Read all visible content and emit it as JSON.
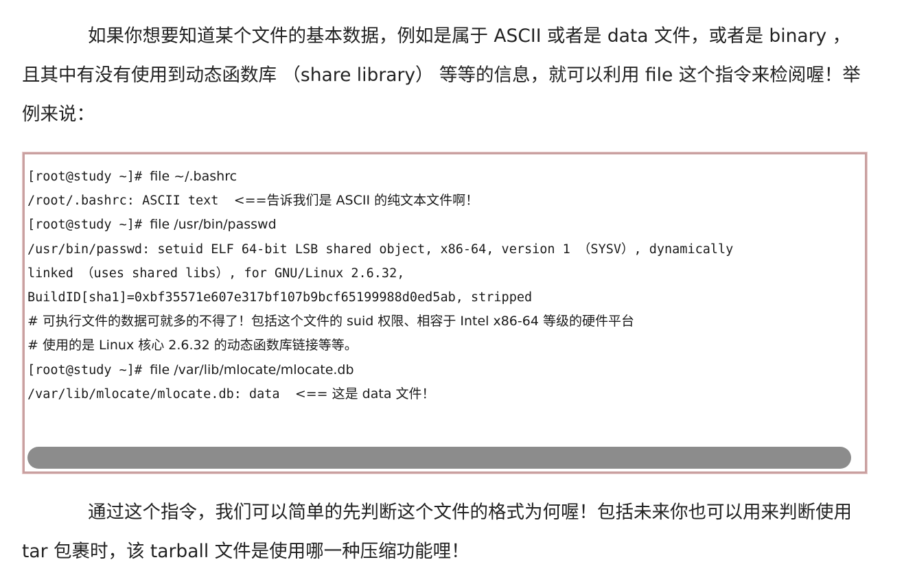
{
  "intro_paragraph": "如果你想要知道某个文件的基本数据，例如是属于 ASCII 或者是 data 文件，或者是 binary ， 且其中有没有使用到动态函数库 （share library） 等等的信息，就可以利用 file 这个指令来检阅喔！举例来说：",
  "code_block": {
    "lines": [
      {
        "mono": "[root@study ~]# ",
        "prose": "file ~/.bashrc"
      },
      {
        "mono": "/root/.bashrc: ASCII text  ",
        "prose": "<==告诉我们是 ASCII 的纯文本文件啊！"
      },
      {
        "mono": "[root@study ~]# ",
        "prose": "file /usr/bin/passwd"
      },
      {
        "mono": "/usr/bin/passwd: setuid ELF 64-bit LSB shared object, x86-64, version 1 （SYSV）, dynamically",
        "prose": ""
      },
      {
        "mono": "linked （uses shared libs）, for GNU/Linux 2.6.32,",
        "prose": ""
      },
      {
        "mono": "BuildID[sha1]=0xbf35571e607e317bf107b9bcf65199988d0ed5ab, stripped",
        "prose": ""
      },
      {
        "mono": "",
        "prose": "# 可执行文件的数据可就多的不得了！包括这个文件的 suid 权限、相容于 Intel x86-64 等级的硬件平台"
      },
      {
        "mono": "",
        "prose": "# 使用的是 Linux 核心 2.6.32 的动态函数库链接等等。"
      },
      {
        "mono": "[root@study ~]# ",
        "prose": "file /var/lib/mlocate/mlocate.db"
      },
      {
        "mono": "/var/lib/mlocate/mlocate.db: data  ",
        "prose": "<== 这是 data 文件！"
      }
    ]
  },
  "outro_paragraph": "通过这个指令，我们可以简单的先判断这个文件的格式为何喔！包括未来你也可以用来判断使用 tar 包裹时，该 tarball 文件是使用哪一种压缩功能哩！",
  "colors": {
    "code_border": "#c9a0a0",
    "scrollbar": "#8c8c8c",
    "text": "#222222"
  }
}
